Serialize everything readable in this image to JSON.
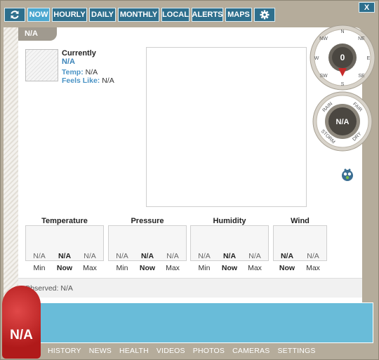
{
  "nav": {
    "refresh_icon": "refresh-icon",
    "tabs": [
      "NOW",
      "HOURLY",
      "DAILY",
      "MONTHLY",
      "LOCAL",
      "ALERTS",
      "MAPS"
    ],
    "settings_icon": "gear-icon",
    "close_label": "X"
  },
  "location": "N/A",
  "current": {
    "title": "Currently",
    "condition": "N/A",
    "temp_label": "Temp:",
    "temp_value": "N/A",
    "feels_label": "Feels Like:",
    "feels_value": "N/A"
  },
  "compass": {
    "n": "N",
    "ne": "NE",
    "e": "E",
    "se": "SE",
    "s": "S",
    "sw": "SW",
    "w": "W",
    "nw": "NW",
    "value": "0"
  },
  "barometer": {
    "rain": "RAIN",
    "fair": "FAIR",
    "storm": "STORM",
    "dry": "DRY",
    "value": "N/A"
  },
  "stats": {
    "temperature": {
      "title": "Temperature",
      "min": "N/A",
      "now": "N/A",
      "max": "N/A",
      "min_label": "Min",
      "now_label": "Now",
      "max_label": "Max"
    },
    "pressure": {
      "title": "Pressure",
      "min": "N/A",
      "now": "N/A",
      "max": "N/A",
      "min_label": "Min",
      "now_label": "Now",
      "max_label": "Max"
    },
    "humidity": {
      "title": "Humidity",
      "min": "N/A",
      "now": "N/A",
      "max": "N/A",
      "min_label": "Min",
      "now_label": "Now",
      "max_label": "Max"
    },
    "wind": {
      "title": "Wind",
      "now": "N/A",
      "max": "N/A",
      "now_label": "Now",
      "max_label": "Max"
    }
  },
  "observed": "Observed: N/A",
  "big_temp": "N/A",
  "bottom_nav": [
    "HISTORY",
    "NEWS",
    "HEALTH",
    "VIDEOS",
    "PHOTOS",
    "CAMERAS",
    "SETTINGS"
  ],
  "colors": {
    "nav_bg": "#2e6f8d",
    "nav_active": "#4aa7d0",
    "accent_blue": "#69bcd9",
    "temp_red": "#c62a2a"
  }
}
